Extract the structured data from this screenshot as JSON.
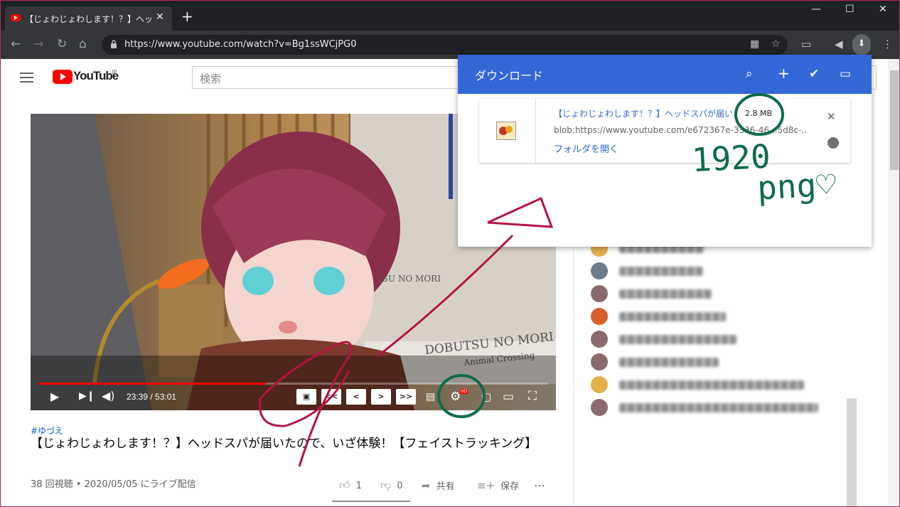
{
  "browser": {
    "tab_title": "【じょわじょわします！？】ヘッドスパが届いたので…",
    "tab_close": "✕",
    "new_tab": "+",
    "window_controls": {
      "minimize": "—",
      "maximize": "☐",
      "close": "✕"
    },
    "url": "https://www.youtube.com/watch?v=Bg1ssWCjPG0",
    "icons": [
      "back-arrow-icon",
      "forward-arrow-icon",
      "reload-icon",
      "home-icon",
      "lock-icon",
      "qr-code-icon",
      "star-icon",
      "media-router-icon",
      "mute-icon",
      "download-icon",
      "kebab-menu-icon"
    ]
  },
  "youtube": {
    "logo_text": "YouTube",
    "country_code": "JP",
    "search_placeholder": "検索"
  },
  "video": {
    "time": "23:39 / 53:01",
    "progress_fraction": 0.446,
    "skip_buttons": [
      "<<",
      "<",
      ">",
      ">>"
    ],
    "hd_badge": "HD"
  },
  "meta": {
    "hashtag": "#ゆづえ",
    "title": "【じょわじょわします！？】ヘッドスパが届いたので、いざ体験！【フェイストラッキング】",
    "view_info": "38 回視聴 • 2020/05/05 にライブ配信",
    "like_count": "1",
    "dislike_count": "0",
    "share_label": "共有",
    "save_label": "保存",
    "more_label": "⋯"
  },
  "download_panel": {
    "title": "ダウンロード",
    "filename": "【じょわじょわします！？】ヘッドスパが届いたので",
    "size": "2.8 MB",
    "url": "blob:https://www.youtube.com/e672367e-3336-46...5d8c-...",
    "open_folder": "フォルダを開く",
    "close": "✕"
  },
  "annotation": {
    "text_line1": "1920",
    "text_line2": "png♡",
    "color": "#0e6b4c",
    "arrow_color": "#b31442"
  },
  "chat": {
    "avatar_colors": [
      "#6b7d8a",
      "#e3b04b",
      "#8a6a6a",
      "#e3b04b",
      "#e3b04b",
      "#6b7d8a",
      "#8a6a6a",
      "#d95f2a",
      "#8a6a6a",
      "#8a6a6a",
      "#e3b04b",
      "#8a6a6a"
    ]
  }
}
